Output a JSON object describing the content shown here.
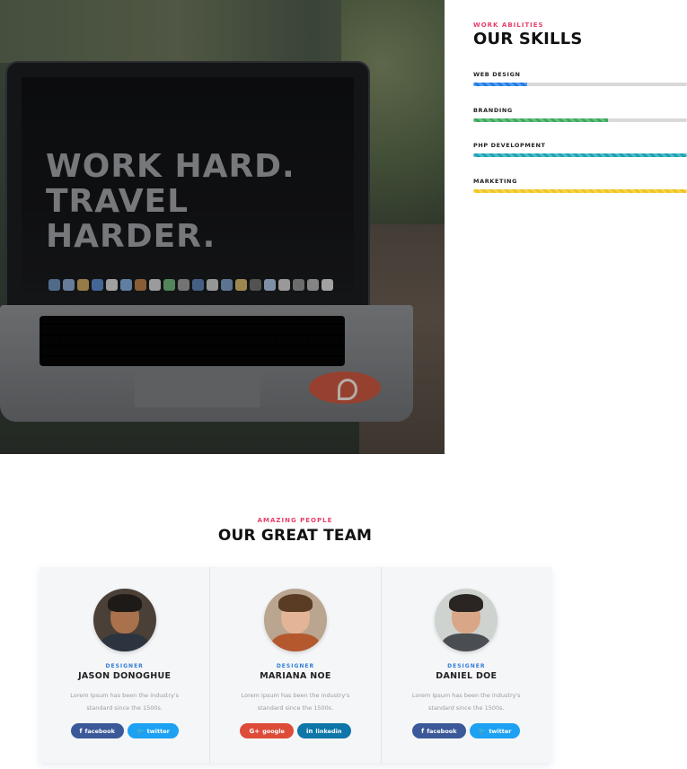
{
  "skills": {
    "eyebrow": "WORK ABILITIES",
    "title": "OUR SKILLS",
    "items": [
      {
        "label": "WEB DESIGN",
        "percent": 25,
        "color": "#1f7be6"
      },
      {
        "label": "BRANDING",
        "percent": 63,
        "color": "#3aa95a"
      },
      {
        "label": "PHP DEVELOPMENT",
        "percent": 100,
        "color": "#1aa3b3"
      },
      {
        "label": "MARKETING",
        "percent": 100,
        "color": "#f0c419"
      }
    ]
  },
  "hero": {
    "screen_line1": "WORK HARD.",
    "screen_line2": "TRAVEL HARDER."
  },
  "team": {
    "eyebrow": "AMAZING PEOPLE",
    "title": "OUR GREAT TEAM",
    "members": [
      {
        "role": "DESIGNER",
        "name": "JASON DONOGHUE",
        "bio": "Lorem Ipsum has been the industry's standard since the 1500s.",
        "socials": [
          {
            "icon": "facebook-icon",
            "glyph": "f",
            "label": "facebook",
            "color": "#3b5998"
          },
          {
            "icon": "twitter-icon",
            "glyph": "🐦",
            "label": "twitter",
            "color": "#1da1f2"
          }
        ]
      },
      {
        "role": "DESIGNER",
        "name": "MARIANA NOE",
        "bio": "Lorem Ipsum has been the industry's standard since the 1500s.",
        "socials": [
          {
            "icon": "google-plus-icon",
            "glyph": "G+",
            "label": "google",
            "color": "#dd4b39"
          },
          {
            "icon": "linkedin-icon",
            "glyph": "in",
            "label": "linkedin",
            "color": "#0e76a8"
          }
        ]
      },
      {
        "role": "DESIGNER",
        "name": "DANIEL DOE",
        "bio": "Lorem Ipsum has been the industry's standard since the 1500s.",
        "socials": [
          {
            "icon": "facebook-icon",
            "glyph": "f",
            "label": "facebook",
            "color": "#3b5998"
          },
          {
            "icon": "twitter-icon",
            "glyph": "🐦",
            "label": "twitter",
            "color": "#1da1f2"
          }
        ]
      }
    ]
  }
}
